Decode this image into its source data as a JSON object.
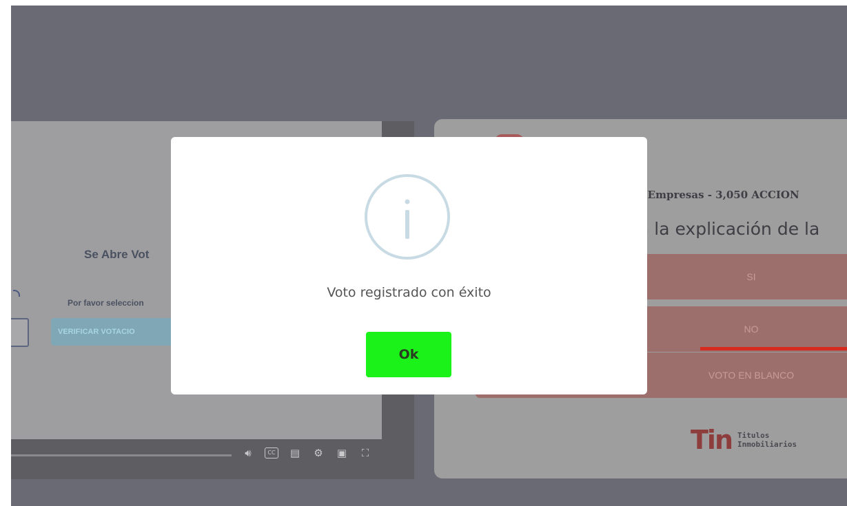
{
  "video_panel": {
    "heading": "Se Abre Vot",
    "sub": "Por favor seleccion",
    "verify_button": "VERIFICAR VOTACIO"
  },
  "vote_panel": {
    "company_line": "2 Empresas - 3,050 ACCION",
    "question": "a la explicación de la",
    "options": [
      "SI",
      "NO",
      "VOTO EN BLANCO"
    ],
    "brand_logo": "Tin",
    "brand_line1": "Titulos",
    "brand_line2": "Inmobiliarios"
  },
  "modal": {
    "icon": "info-icon",
    "message": "Voto registrado con éxito",
    "ok_label": "Ok"
  },
  "colors": {
    "ok_green": "#1af21a",
    "info_ring": "#c8dae3",
    "overlay": "#6a6a74",
    "accent_red": "#d72b20"
  }
}
